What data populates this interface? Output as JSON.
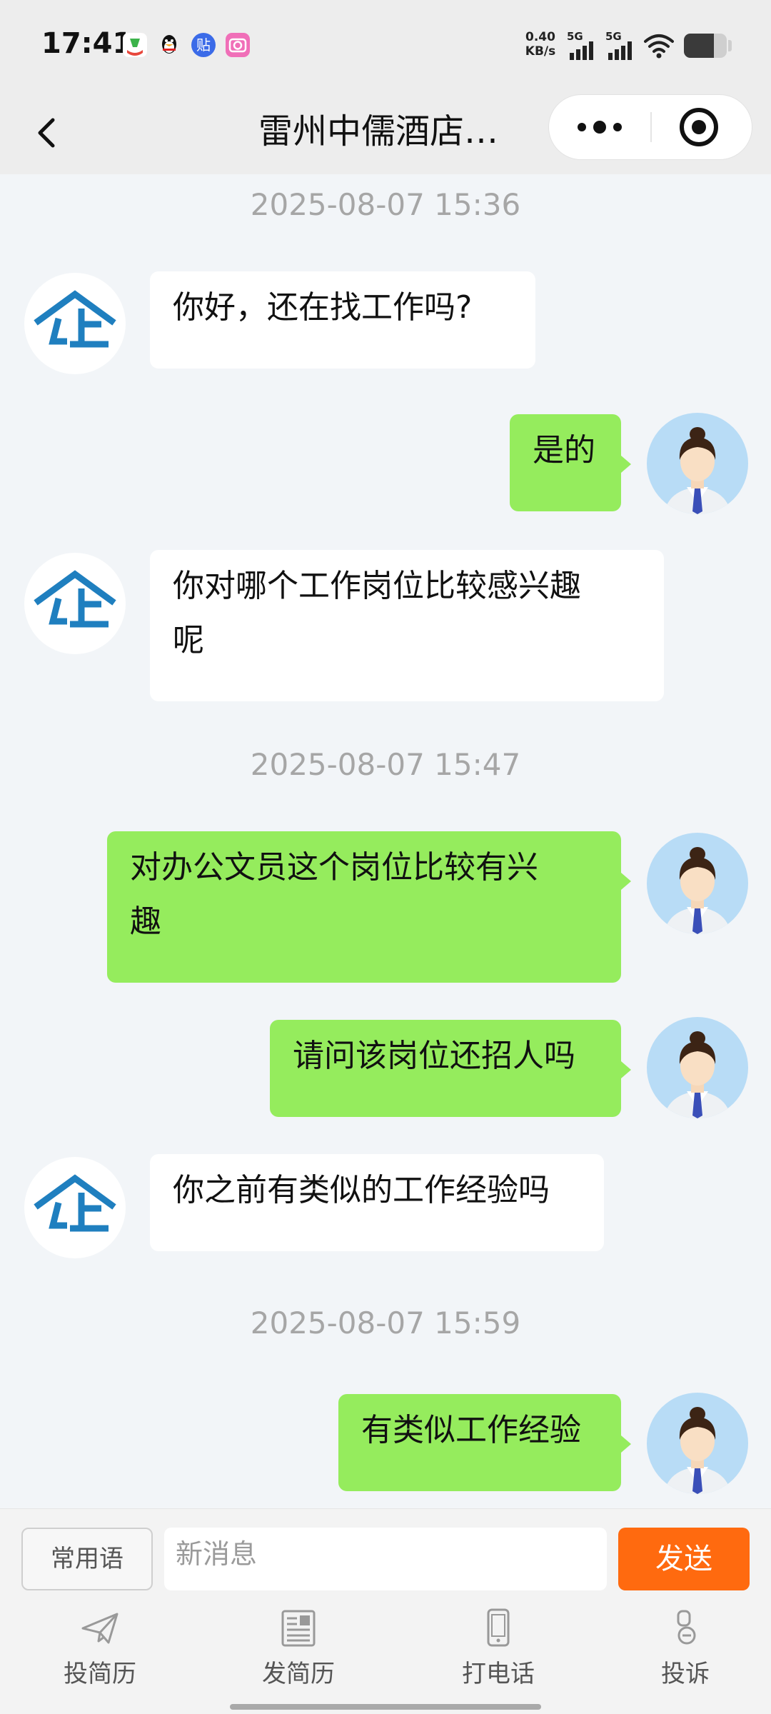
{
  "status_bar": {
    "time": "17:41",
    "app_icons": [
      {
        "name": "red-app-icon",
        "glyph": "❤",
        "color": "#e8473c"
      },
      {
        "name": "qq-icon",
        "glyph": "🐧",
        "color": "#111111"
      },
      {
        "name": "tieba-icon",
        "glyph": "贴",
        "color": "#3b6be8"
      },
      {
        "name": "camera-app-icon",
        "glyph": "◎",
        "color": "#f06fb8"
      }
    ],
    "net_speed_value": "0.40",
    "net_speed_unit": "KB/s",
    "sim1_label": "5G",
    "sim2_label": "5G",
    "battery_level": 0.7
  },
  "nav": {
    "title": "雷州中儒酒店…"
  },
  "chat": {
    "items": [
      {
        "kind": "time",
        "text": "2025-08-07 15:36"
      },
      {
        "kind": "msg",
        "side": "left",
        "lines": [
          "你好，还在找工作吗?"
        ]
      },
      {
        "kind": "msg",
        "side": "right",
        "lines": [
          "是的"
        ]
      },
      {
        "kind": "msg",
        "side": "left",
        "lines": [
          "你对哪个工作岗位比较感兴趣",
          "呢"
        ]
      },
      {
        "kind": "time",
        "text": "2025-08-07 15:47"
      },
      {
        "kind": "msg",
        "side": "right",
        "lines": [
          "对办公文员这个岗位比较有兴",
          "趣"
        ]
      },
      {
        "kind": "msg",
        "side": "right",
        "lines": [
          "请问该岗位还招人吗"
        ]
      },
      {
        "kind": "msg",
        "side": "left",
        "lines": [
          "你之前有类似的工作经验吗"
        ]
      },
      {
        "kind": "time",
        "text": "2025-08-07 15:59"
      },
      {
        "kind": "msg",
        "side": "right",
        "lines": [
          "有类似工作经验"
        ]
      }
    ]
  },
  "input_bar": {
    "phrases_label": "常用语",
    "input_placeholder": "新消息",
    "input_value": "",
    "send_label": "发送"
  },
  "tabs": [
    {
      "label": "投简历",
      "icon": "paper-plane-icon"
    },
    {
      "label": "发简历",
      "icon": "resume-icon"
    },
    {
      "label": "打电话",
      "icon": "phone-icon"
    },
    {
      "label": "投诉",
      "icon": "complaint-icon"
    }
  ],
  "colors": {
    "bubble_self": "#95ec5d",
    "bubble_other": "#ffffff",
    "send_button": "#ff6a0f",
    "company_logo": "#1f7fbf",
    "timestamp": "#a6a6a6"
  }
}
